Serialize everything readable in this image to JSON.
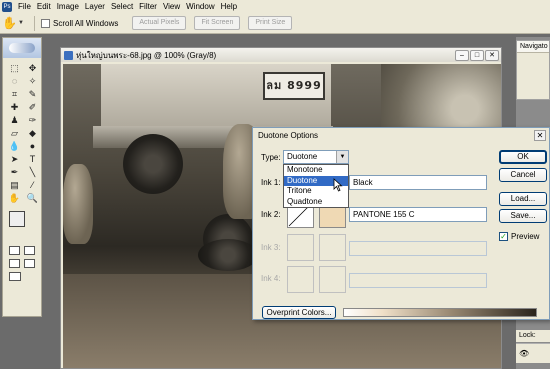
{
  "menubar": {
    "items": [
      "File",
      "Edit",
      "Image",
      "Layer",
      "Select",
      "Filter",
      "View",
      "Window",
      "Help"
    ]
  },
  "options_bar": {
    "tool_icon": "hand-icon",
    "scroll_all_label": "Scroll All Windows",
    "scroll_all_checked": false,
    "buttons": [
      "Actual Pixels",
      "Fit Screen",
      "Print Size"
    ]
  },
  "document": {
    "title": "หุ่นใหญ่บนพระ-68.jpg @ 100% (Gray/8)",
    "plate_text": "ลม 8999"
  },
  "panels": {
    "navigator_label": "Navigato",
    "lock_label": "Lock:"
  },
  "dialog": {
    "title": "Duotone Options",
    "type_label": "Type:",
    "type_value": "Duotone",
    "type_options": [
      "Monotone",
      "Duotone",
      "Tritone",
      "Quadtone"
    ],
    "type_selected_index": 1,
    "inks": [
      {
        "label": "Ink 1:",
        "name": "Black",
        "color": "#000000",
        "enabled": true
      },
      {
        "label": "Ink 2:",
        "name": "PANTONE 155 C",
        "color": "#efd9b4",
        "enabled": true
      },
      {
        "label": "Ink 3:",
        "name": "",
        "color": "",
        "enabled": false
      },
      {
        "label": "Ink 4:",
        "name": "",
        "color": "",
        "enabled": false
      }
    ],
    "buttons": {
      "ok": "OK",
      "cancel": "Cancel",
      "load": "Load...",
      "save": "Save..."
    },
    "preview_label": "Preview",
    "preview_checked": true,
    "overprint_label": "Overprint Colors..."
  },
  "colors": {
    "dialog_bg": "#ece9d8",
    "selection": "#316ac5",
    "ink2": "#efd9b4"
  }
}
